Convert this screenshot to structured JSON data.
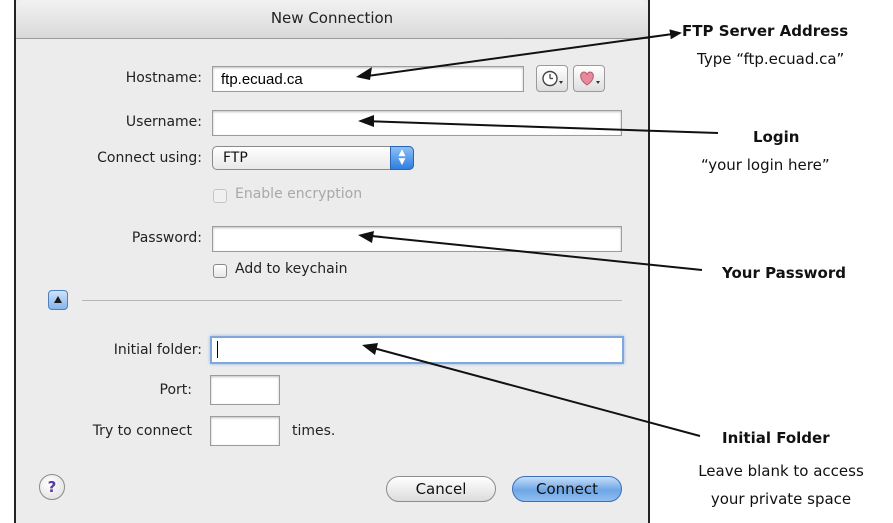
{
  "dialog": {
    "title": "New Connection",
    "hostname_label": "Hostname:",
    "hostname_value": "ftp.ecuad.ca",
    "username_label": "Username:",
    "username_value": "",
    "connect_using_label": "Connect using:",
    "connect_using_value": "FTP",
    "enable_encryption_label": "Enable encryption",
    "password_label": "Password:",
    "password_value": "",
    "add_keychain_label": "Add to keychain",
    "initial_folder_label": "Initial folder:",
    "initial_folder_value": "",
    "port_label": "Port:",
    "port_value": "",
    "try_connect_label": "Try to connect",
    "try_connect_value": "",
    "times_label": "times.",
    "help_label": "?",
    "cancel_label": "Cancel",
    "connect_label": "Connect",
    "icons": [
      "history-clock-icon",
      "favorites-heart-icon",
      "disclosure-triangle-icon",
      "help-icon",
      "popup-arrows-icon"
    ]
  },
  "annotations": {
    "ftp_title": "FTP Server Address",
    "ftp_desc": "Type “ftp.ecuad.ca”",
    "login_title": "Login",
    "login_desc": "“your login here”",
    "password_title": "Your Password",
    "folder_title": "Initial Folder",
    "folder_desc_1": "Leave blank to access",
    "folder_desc_2": "your private space"
  },
  "colors": {
    "accent_blue": "#6ea6e6",
    "window_bg": "#ececec",
    "help_glyph": "#5a3aa0"
  }
}
